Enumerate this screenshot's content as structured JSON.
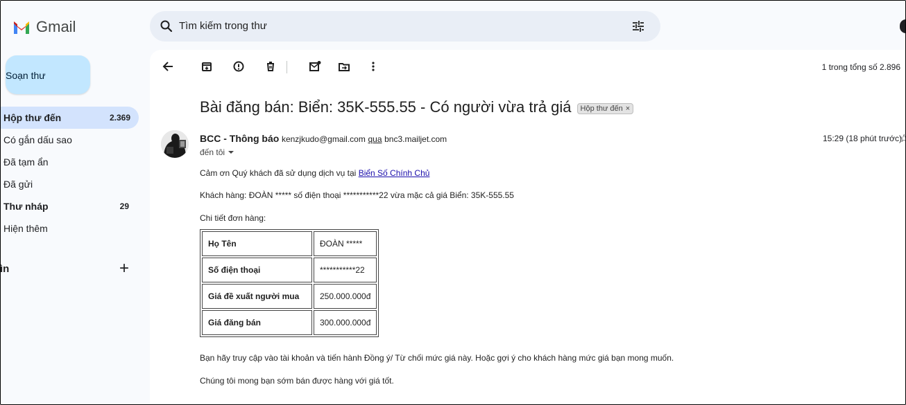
{
  "app": {
    "name": "Gmail"
  },
  "search": {
    "placeholder": "Tìm kiếm trong thư"
  },
  "sidebar": {
    "compose_label": "Soạn thư",
    "items": [
      {
        "label": "Hộp thư đến",
        "count": "2.369"
      },
      {
        "label": "Có gắn dấu sao",
        "count": ""
      },
      {
        "label": "Đã tạm ẩn",
        "count": ""
      },
      {
        "label": "Đã gửi",
        "count": ""
      },
      {
        "label": "Thư nháp",
        "count": "29"
      },
      {
        "label": "Hiện thêm",
        "count": ""
      }
    ],
    "labels_title": "ìn",
    "labels_add": "+"
  },
  "toolbar": {
    "icons": [
      "back-arrow-icon",
      "archive-icon",
      "report-spam-icon",
      "delete-icon",
      "mark-unread-icon",
      "move-to-icon",
      "more-icon"
    ],
    "pager": "1 trong tổng số 2.896"
  },
  "email": {
    "subject": "Bài đăng bán: Biển: 35K-555.55 - Có người vừa trả giá",
    "folder_chip": "Hộp thư đến",
    "chip_close": "×",
    "sender_name": "BCC - Thông báo",
    "sender_email": "kenzjkudo@gmail.com",
    "via_label": "qua",
    "via_domain": "bnc3.mailjet.com",
    "to_label": "đến tôi",
    "time": "15:29 (18 phút trước)",
    "body": {
      "thanks_prefix": "Cảm ơn Quý khách đã sử dụng dịch vụ tại ",
      "thanks_link": "Biển Số Chính Chủ",
      "customer_line": "Khách hàng: ĐOÀN ***** số điện thoại ***********22 vừa mặc cả giá Biển: 35K-555.55",
      "details_title": "Chi tiết đơn hàng:",
      "table": [
        {
          "key": "Họ Tên",
          "value": "ĐOÀN *****"
        },
        {
          "key": "Số điện thoại",
          "value": "***********22"
        },
        {
          "key": "Giá đề xuất người mua",
          "value": "250.000.000đ"
        },
        {
          "key": "Giá đăng bán",
          "value": "300.000.000đ"
        }
      ],
      "instruction": "Bạn hãy truy cập vào tài khoản và tiến hành Đồng ý/ Từ chối mức giá này. Hoặc gợi ý cho khách hàng mức giá bạn mong muốn.",
      "closing": "Chúng tôi mong bạn sớm bán được hàng với giá tốt."
    }
  }
}
